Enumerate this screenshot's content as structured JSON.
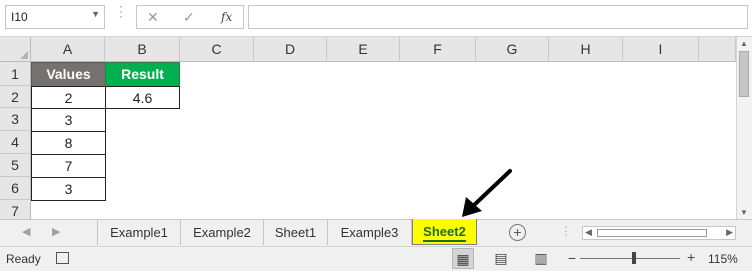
{
  "formula_bar": {
    "name_box": "I10",
    "cancel_icon": "✕",
    "enter_icon": "✓",
    "fx_label": "fx",
    "formula": ""
  },
  "columns": [
    "A",
    "B",
    "C",
    "D",
    "E",
    "F",
    "G",
    "H",
    "I"
  ],
  "rows": [
    "1",
    "2",
    "3",
    "4",
    "5",
    "6",
    "7"
  ],
  "cells": {
    "A1": "Values",
    "B1": "Result",
    "A2": "2",
    "B2": "4.6",
    "A3": "3",
    "A4": "8",
    "A5": "7",
    "A6": "3"
  },
  "colors": {
    "values_header_bg": "#767171",
    "result_header_bg": "#00b050",
    "active_tab_bg": "#ffff00",
    "annotation_arrow": "#000000"
  },
  "sheet_tabs": [
    {
      "label": "Example1",
      "active": false
    },
    {
      "label": "Example2",
      "active": false
    },
    {
      "label": "Sheet1",
      "active": false
    },
    {
      "label": "Example3",
      "active": false
    },
    {
      "label": "Sheet2",
      "active": true
    }
  ],
  "add_sheet_icon": "+",
  "status_bar": {
    "ready": "Ready",
    "zoom": "115%",
    "zoom_minus": "−",
    "zoom_plus": "+"
  }
}
